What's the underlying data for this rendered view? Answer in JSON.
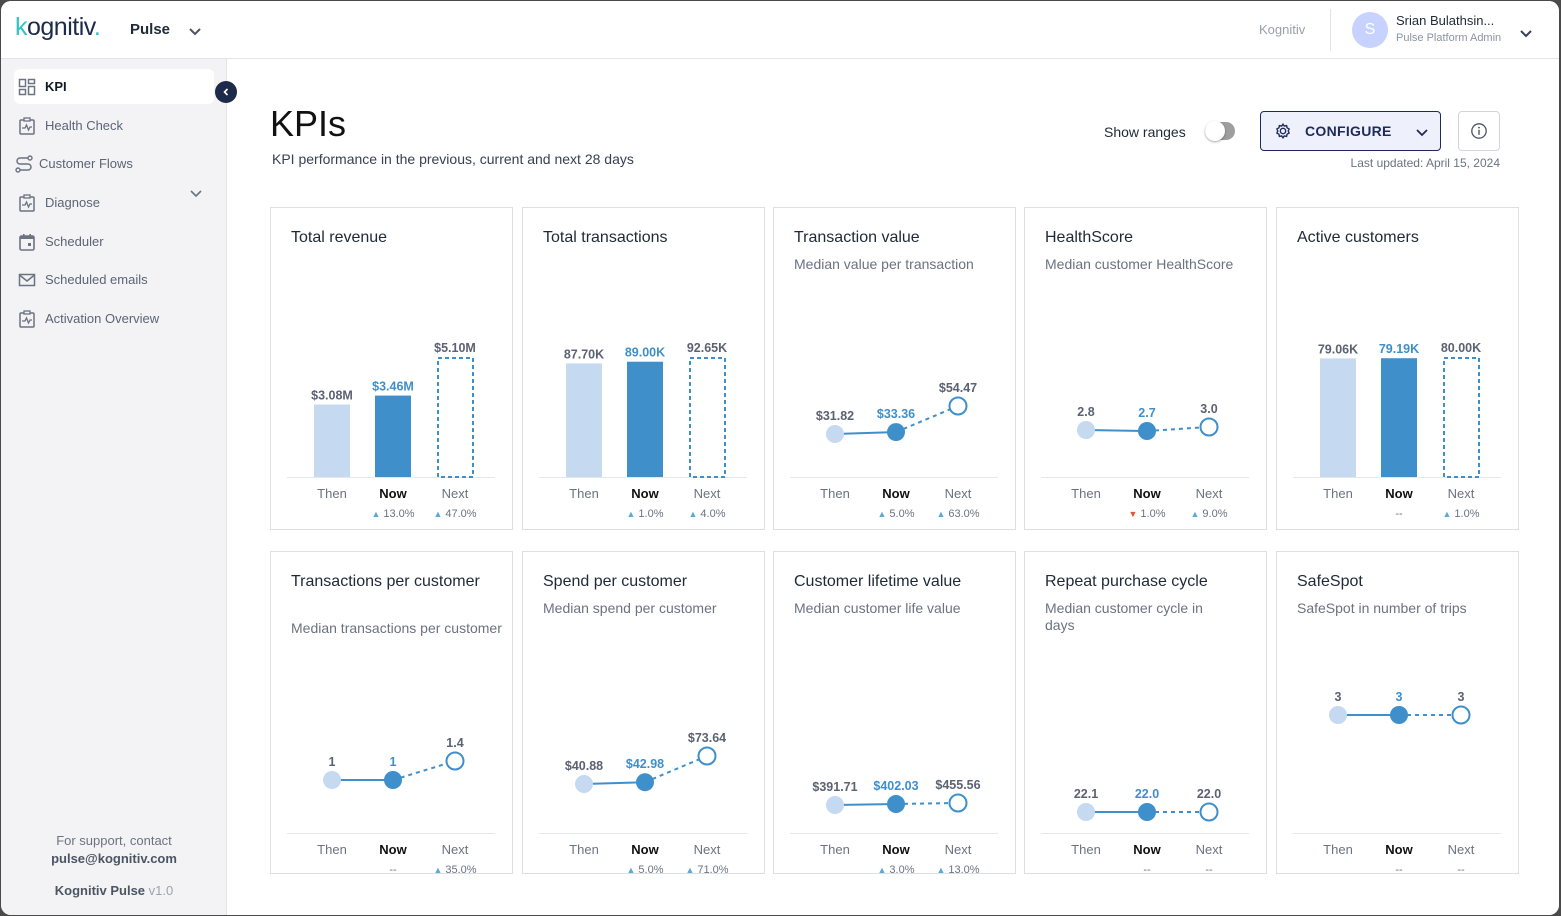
{
  "topbar": {
    "logo_text_k": "k",
    "logo_text_rest": "ognitiv",
    "logo_dot": ".",
    "product": "Pulse",
    "org": "Kognitiv",
    "user": {
      "initial": "S",
      "name": "Srian Bulathsin...",
      "role": "Pulse Platform Admin"
    }
  },
  "sidebar": {
    "items": [
      {
        "label": "KPI",
        "icon": "dashboard-icon",
        "active": true
      },
      {
        "label": "Health Check",
        "icon": "clipboard-pulse-icon",
        "expandable": true
      },
      {
        "label": "Customer Flows",
        "icon": "flow-icon"
      },
      {
        "label": "Diagnose",
        "icon": "clipboard-pulse-icon"
      },
      {
        "label": "Scheduler",
        "icon": "calendar-icon"
      },
      {
        "label": "Scheduled emails",
        "icon": "mail-icon"
      },
      {
        "label": "Activation Overview",
        "icon": "clipboard-pulse-icon"
      }
    ],
    "support_line": "For support, contact",
    "support_email": "pulse@kognitiv.com",
    "version_name": "Kognitiv Pulse",
    "version_num": "v1.0"
  },
  "header": {
    "title": "KPIs",
    "subtitle": "KPI performance in the previous, current and next 28 days",
    "show_ranges_label": "Show ranges",
    "show_ranges_on": false,
    "configure_label": "CONFIGURE",
    "last_updated": "Last updated: April 15, 2024"
  },
  "x_labels": [
    "Then",
    "Now",
    "Next"
  ],
  "colors": {
    "then": "#c5daf0",
    "now": "#3f8fcb",
    "next": "#3f8fcb",
    "up": "#5aa9d6",
    "down": "#e5533d"
  },
  "cards": [
    {
      "title": "Total revenue",
      "subtitle": "",
      "type": "bar",
      "values": [
        3.08,
        3.46,
        5.1
      ],
      "labels": [
        "$3.08M",
        "$3.46M",
        "$5.10M"
      ],
      "deltas": [
        null,
        {
          "dir": "up",
          "text": "13.0%"
        },
        {
          "dir": "up",
          "text": "47.0%"
        }
      ]
    },
    {
      "title": "Total transactions",
      "subtitle": "",
      "type": "bar",
      "values": [
        87.7,
        89.0,
        92.65
      ],
      "labels": [
        "87.70K",
        "89.00K",
        "92.65K"
      ],
      "deltas": [
        null,
        {
          "dir": "up",
          "text": "1.0%"
        },
        {
          "dir": "up",
          "text": "4.0%"
        }
      ]
    },
    {
      "title": "Transaction value",
      "subtitle": "Median value per transaction",
      "type": "line",
      "values": [
        31.82,
        33.36,
        54.47
      ],
      "labels": [
        "$31.82",
        "$33.36",
        "$54.47"
      ],
      "deltas": [
        null,
        {
          "dir": "up",
          "text": "5.0%"
        },
        {
          "dir": "up",
          "text": "63.0%"
        }
      ]
    },
    {
      "title": "HealthScore",
      "subtitle": "Median customer HealthScore",
      "type": "line",
      "values": [
        2.8,
        2.7,
        3.0
      ],
      "labels": [
        "2.8",
        "2.7",
        "3.0"
      ],
      "deltas": [
        null,
        {
          "dir": "down",
          "text": "1.0%"
        },
        {
          "dir": "up",
          "text": "9.0%"
        }
      ]
    },
    {
      "title": "Active customers",
      "subtitle": "",
      "type": "bar",
      "values": [
        79.06,
        79.19,
        80.0
      ],
      "labels": [
        "79.06K",
        "79.19K",
        "80.00K"
      ],
      "deltas": [
        null,
        {
          "dir": "none",
          "text": "--"
        },
        {
          "dir": "up",
          "text": "1.0%"
        }
      ]
    },
    {
      "title": "Transactions per customer",
      "subtitle": "Median transactions per customer",
      "type": "line",
      "values": [
        1,
        1,
        1.4
      ],
      "labels": [
        "1",
        "1",
        "1.4"
      ],
      "deltas": [
        null,
        {
          "dir": "none",
          "text": "--"
        },
        {
          "dir": "up",
          "text": "35.0%"
        }
      ]
    },
    {
      "title": "Spend per customer",
      "subtitle": "Median spend per customer",
      "type": "line",
      "values": [
        40.88,
        42.98,
        73.64
      ],
      "labels": [
        "$40.88",
        "$42.98",
        "$73.64"
      ],
      "deltas": [
        null,
        {
          "dir": "up",
          "text": "5.0%"
        },
        {
          "dir": "up",
          "text": "71.0%"
        }
      ]
    },
    {
      "title": "Customer lifetime value",
      "subtitle": "Median customer life value",
      "type": "line",
      "values": [
        391.71,
        402.03,
        455.56
      ],
      "labels": [
        "$391.71",
        "$402.03",
        "$455.56"
      ],
      "deltas": [
        null,
        {
          "dir": "up",
          "text": "3.0%"
        },
        {
          "dir": "up",
          "text": "13.0%"
        }
      ]
    },
    {
      "title": "Repeat purchase cycle",
      "subtitle": "Median customer cycle in days",
      "type": "line",
      "values": [
        22.1,
        22.0,
        22.0
      ],
      "labels": [
        "22.1",
        "22.0",
        "22.0"
      ],
      "deltas": [
        null,
        {
          "dir": "none",
          "text": "--"
        },
        {
          "dir": "none",
          "text": "--"
        }
      ]
    },
    {
      "title": "SafeSpot",
      "subtitle": "SafeSpot in number of trips",
      "type": "line",
      "values": [
        3,
        3,
        3
      ],
      "labels": [
        "3",
        "3",
        "3"
      ],
      "deltas": [
        null,
        {
          "dir": "none",
          "text": "--"
        },
        {
          "dir": "none",
          "text": "--"
        }
      ]
    }
  ],
  "chart_data": [
    {
      "type": "bar",
      "title": "Total revenue",
      "categories": [
        "Then",
        "Now",
        "Next"
      ],
      "values": [
        3.08,
        3.46,
        5.1
      ],
      "unit": "$M",
      "value_labels": [
        "$3.08M",
        "$3.46M",
        "$5.10M"
      ],
      "annotations": [
        "",
        "▲ 13.0%",
        "▲ 47.0%"
      ]
    },
    {
      "type": "bar",
      "title": "Total transactions",
      "categories": [
        "Then",
        "Now",
        "Next"
      ],
      "values": [
        87.7,
        89.0,
        92.65
      ],
      "unit": "K",
      "value_labels": [
        "87.70K",
        "89.00K",
        "92.65K"
      ],
      "annotations": [
        "",
        "▲ 1.0%",
        "▲ 4.0%"
      ]
    },
    {
      "type": "line",
      "title": "Transaction value",
      "subtitle": "Median value per transaction",
      "categories": [
        "Then",
        "Now",
        "Next"
      ],
      "values": [
        31.82,
        33.36,
        54.47
      ],
      "annotations": [
        "",
        "▲ 5.0%",
        "▲ 63.0%"
      ]
    },
    {
      "type": "line",
      "title": "HealthScore",
      "subtitle": "Median customer HealthScore",
      "categories": [
        "Then",
        "Now",
        "Next"
      ],
      "values": [
        2.8,
        2.7,
        3.0
      ],
      "annotations": [
        "",
        "▼ 1.0%",
        "▲ 9.0%"
      ]
    },
    {
      "type": "bar",
      "title": "Active customers",
      "categories": [
        "Then",
        "Now",
        "Next"
      ],
      "values": [
        79.06,
        79.19,
        80.0
      ],
      "unit": "K",
      "value_labels": [
        "79.06K",
        "79.19K",
        "80.00K"
      ],
      "annotations": [
        "",
        "--",
        "▲ 1.0%"
      ]
    },
    {
      "type": "line",
      "title": "Transactions per customer",
      "subtitle": "Median transactions per customer",
      "categories": [
        "Then",
        "Now",
        "Next"
      ],
      "values": [
        1,
        1,
        1.4
      ],
      "annotations": [
        "",
        "--",
        "▲ 35.0%"
      ]
    },
    {
      "type": "line",
      "title": "Spend per customer",
      "subtitle": "Median spend per customer",
      "categories": [
        "Then",
        "Now",
        "Next"
      ],
      "values": [
        40.88,
        42.98,
        73.64
      ],
      "annotations": [
        "",
        "▲ 5.0%",
        "▲ 71.0%"
      ]
    },
    {
      "type": "line",
      "title": "Customer lifetime value",
      "subtitle": "Median customer life value",
      "categories": [
        "Then",
        "Now",
        "Next"
      ],
      "values": [
        391.71,
        402.03,
        455.56
      ],
      "annotations": [
        "",
        "▲ 3.0%",
        "▲ 13.0%"
      ]
    },
    {
      "type": "line",
      "title": "Repeat purchase cycle",
      "subtitle": "Median customer cycle in days",
      "categories": [
        "Then",
        "Now",
        "Next"
      ],
      "values": [
        22.1,
        22.0,
        22.0
      ],
      "annotations": [
        "",
        "--",
        "--"
      ]
    },
    {
      "type": "line",
      "title": "SafeSpot",
      "subtitle": "SafeSpot in number of trips",
      "categories": [
        "Then",
        "Now",
        "Next"
      ],
      "values": [
        3,
        3,
        3
      ],
      "annotations": [
        "",
        "--",
        "--"
      ]
    }
  ]
}
